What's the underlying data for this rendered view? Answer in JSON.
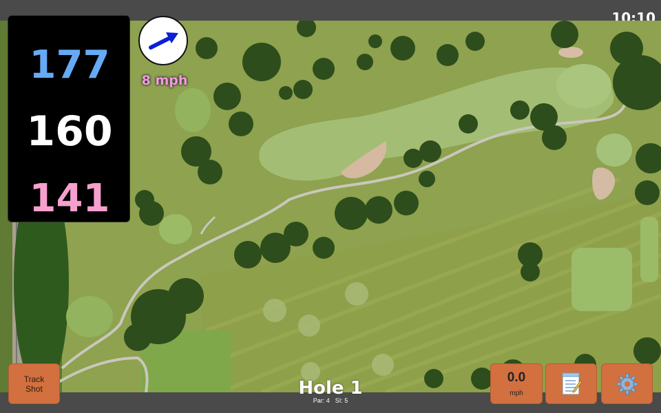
{
  "status": {
    "time": "10:10"
  },
  "yardage": {
    "back": "177",
    "center": "160",
    "front": "141"
  },
  "wind": {
    "speed_label": "8 mph",
    "icon": "wind-direction-arrow-icon"
  },
  "buttons": {
    "track_shot": "Track\nShot",
    "speed_value": "0.0",
    "speed_unit": "mph",
    "notes_icon": "notepad-icon",
    "settings_icon": "gear-icon"
  },
  "hole": {
    "title": "Hole 1",
    "par": "Par: 4",
    "si": "SI: 5"
  },
  "colors": {
    "back_yardage": "#66aaf5",
    "center_yardage": "#ffffff",
    "front_yardage": "#f6a0cd",
    "button_orange": "#d2703f",
    "wind_text": "#f29adf"
  }
}
